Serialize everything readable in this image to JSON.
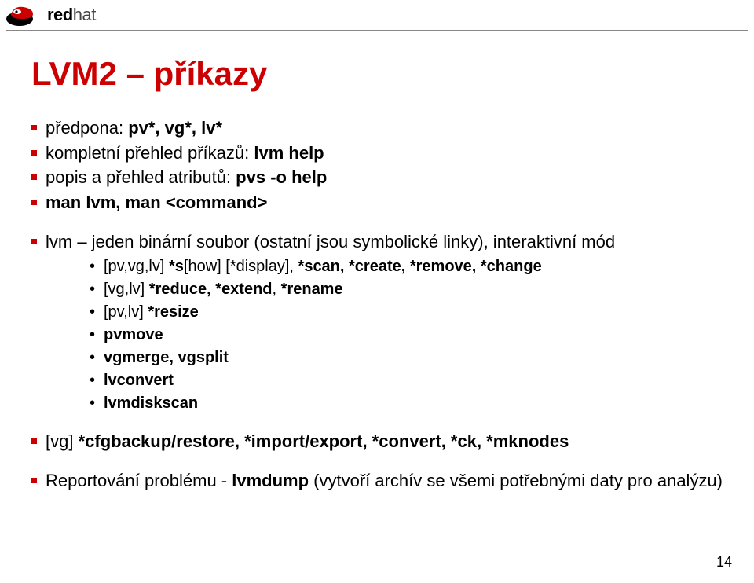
{
  "brand": {
    "red": "red",
    "hat": "hat"
  },
  "title": "LVM2 – příkazy",
  "bullets1": [
    {
      "lead": "předpona: ",
      "bold": "pv*, vg*, lv*"
    },
    {
      "lead": "kompletní přehled příkazů: ",
      "bold": "lvm help"
    },
    {
      "lead": "popis a přehled atributů: ",
      "bold": "pvs -o help"
    },
    {
      "bold": "man lvm, man <command>"
    }
  ],
  "bullets2": {
    "lead": "lvm – jeden binární soubor (ostatní jsou symbolické linky), interaktivní mód",
    "items": [
      {
        "pre": "[pv,vg,lv] ",
        "b1": "*s",
        "mid1": "[how] [*display], ",
        "b2": "*scan, *create, *remove, *change"
      },
      {
        "pre": "[vg,lv] ",
        "b1": "*reduce, *extend",
        "mid1": ", ",
        "b2": "*rename"
      },
      {
        "pre": "[pv,lv] ",
        "b1": "*resize"
      },
      {
        "b1": "pvmove"
      },
      {
        "b1": "vgmerge, vgsplit"
      },
      {
        "b1": "lvconvert"
      },
      {
        "b1": "lvmdiskscan"
      }
    ]
  },
  "bullets3": {
    "pre": "[vg] ",
    "bold": "*cfgbackup/restore, *import/export, *convert, *ck, *mknodes"
  },
  "bullets4": {
    "pre": "Reportování problému - ",
    "bold": "lvmdump",
    "post": " (vytvoří archív se všemi potřebnými daty pro analýzu)"
  },
  "page": "14"
}
